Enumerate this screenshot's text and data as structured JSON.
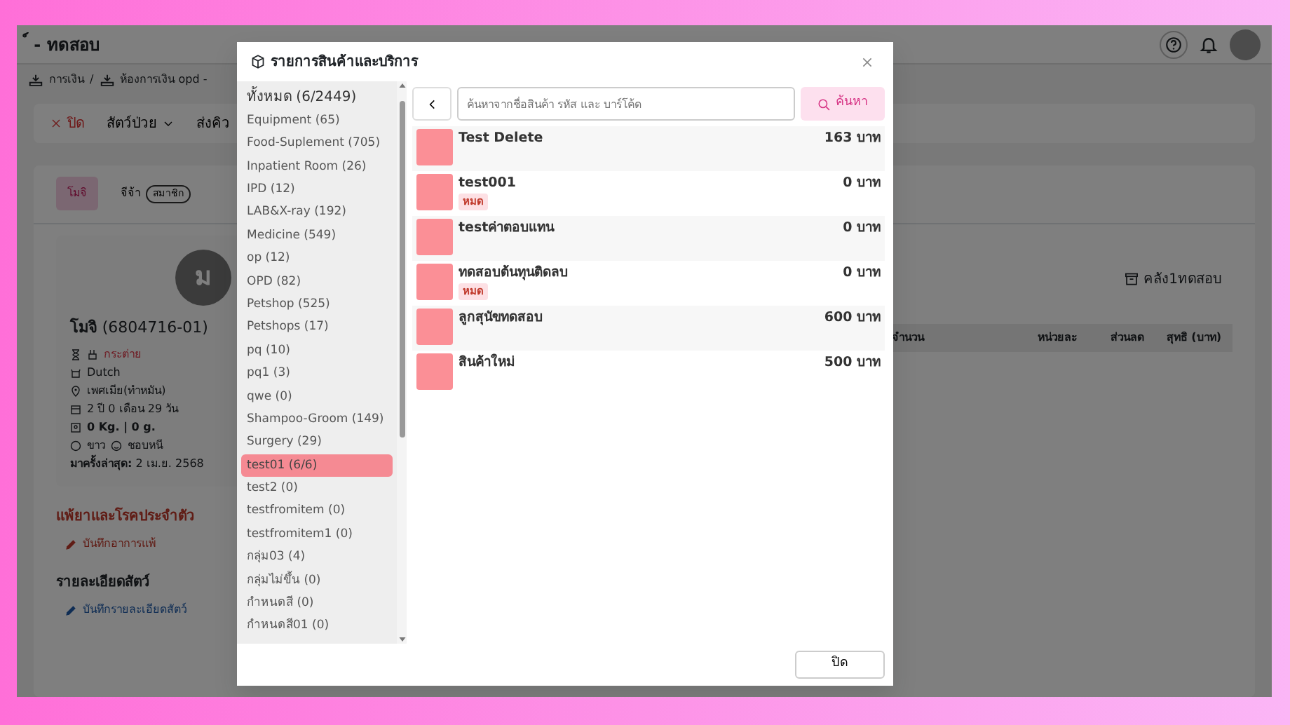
{
  "app": {
    "title": "์ - ทดสอบ",
    "breadcrumb": [
      {
        "label": "การเงิน"
      },
      {
        "separator": "/",
        "label": "ห้องการเงิน opd -"
      }
    ],
    "toolbar": [
      {
        "label": "ปิด",
        "kind": "close"
      },
      {
        "label": "สัตว์ป่วย",
        "kind": "dropdown"
      },
      {
        "label": "ส่งคิว",
        "kind": "dropdown"
      }
    ],
    "patient_tabs": [
      {
        "label": "โมจิ",
        "selected": true
      },
      {
        "label": "จีจ้า",
        "badge": "สมาชิก",
        "selected": false
      }
    ],
    "patient": {
      "initial": "ม",
      "name": "โมจิ",
      "code": "(6804716-01)",
      "species": "กระต่าย",
      "breed": "Dutch",
      "sex": "เพศเมีย(ทำหมัน)",
      "age": "2 ปี 0 เดือน 29 วัน",
      "weight": "0 Kg. | 0 g.",
      "coat": "ขาว",
      "temper": "ชอบหนี",
      "last_visit": "**มาครั้งล่าสุด:** 2 เม.ย. 2568"
    },
    "sections": [
      {
        "title": "แพ้ยาและโรคประจำตัว",
        "link": "บันทึกอาการแพ้",
        "kind": "allergy"
      },
      {
        "title": "รายละเอียดสัตว์",
        "link": "บันทึกรายละเอียดสัตว์",
        "kind": "detail"
      }
    ],
    "stock_location": "คลัง1ทดสอบ",
    "table": {
      "columns": [
        "จำนวน",
        "หน่วยละ",
        "ส่วนลด",
        "สุทธิ (บาท)"
      ]
    }
  },
  "modal": {
    "title": "รายการสินค้าและบริการ",
    "categories": [
      {
        "label": "ทั้งหมด (6/2449)",
        "kind": "all",
        "selected": false
      },
      {
        "label": "Equipment (65)",
        "kind": "group",
        "selected": false
      },
      {
        "label": "Food-Suplement (705)",
        "kind": "group",
        "selected": false
      },
      {
        "label": "Inpatient Room (26)",
        "kind": "group",
        "selected": false
      },
      {
        "label": "IPD (12)",
        "kind": "group",
        "selected": false
      },
      {
        "label": "LAB&X-ray (192)",
        "kind": "group",
        "selected": false
      },
      {
        "label": "Medicine (549)",
        "kind": "group",
        "selected": false
      },
      {
        "label": "op (12)",
        "kind": "group",
        "selected": false
      },
      {
        "label": "OPD (82)",
        "kind": "group",
        "selected": false
      },
      {
        "label": "Petshop (525)",
        "kind": "group",
        "selected": false
      },
      {
        "label": "Petshops (17)",
        "kind": "group",
        "selected": false
      },
      {
        "label": "pq (10)",
        "kind": "group",
        "selected": false
      },
      {
        "label": "pq1 (3)",
        "kind": "group",
        "selected": false
      },
      {
        "label": "qwe (0)",
        "kind": "group",
        "selected": false
      },
      {
        "label": "Shampoo-Groom (149)",
        "kind": "group",
        "selected": false
      },
      {
        "label": "Surgery (29)",
        "kind": "group",
        "selected": false
      },
      {
        "label": "test01 (6/6)",
        "kind": "group",
        "selected": true
      },
      {
        "label": "test2 (0)",
        "kind": "group",
        "selected": false
      },
      {
        "label": "testfromitem (0)",
        "kind": "group",
        "selected": false
      },
      {
        "label": "testfromitem1 (0)",
        "kind": "group",
        "selected": false
      },
      {
        "label": "กลุ่ม03 (4)",
        "kind": "group",
        "selected": false
      },
      {
        "label": "กลุ่มไม่ขึ้น (0)",
        "kind": "group",
        "selected": false
      },
      {
        "label": "กำหนดสี (0)",
        "kind": "group",
        "selected": false
      },
      {
        "label": "กำหนดสี01 (0)",
        "kind": "group",
        "selected": false
      }
    ],
    "search": {
      "placeholder": "ค้นหาจากชื่อสินค้า รหัส และ บาร์โค้ด",
      "button": "ค้นหา"
    },
    "products": [
      {
        "name": "Test Delete",
        "price": "163 บาท"
      },
      {
        "name": "test001",
        "price": "0 บาท",
        "badge": "หมด"
      },
      {
        "name": "testค่าตอบแทน",
        "price": "0 บาท"
      },
      {
        "name": "ทดสอบต้นทุนติดลบ",
        "price": "0 บาท",
        "badge": "หมด"
      },
      {
        "name": "ลูกสุนัขทดสอบ",
        "price": "600 บาท"
      },
      {
        "name": "สินค้าใหม่",
        "price": "500 บาท"
      }
    ],
    "close_button": "ปิด"
  }
}
